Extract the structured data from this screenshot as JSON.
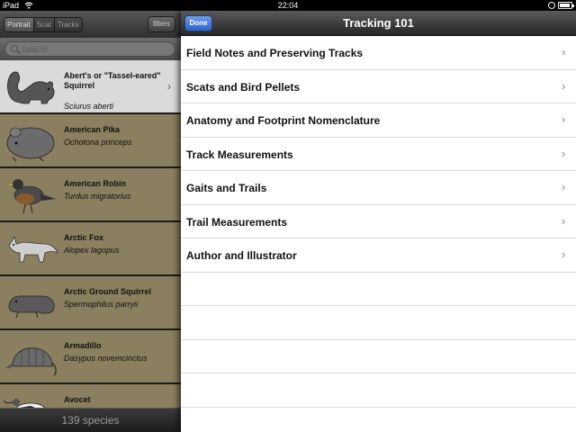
{
  "status_bar": {
    "carrier": "iPad",
    "time": "22:04",
    "battery_level": 0.95
  },
  "left_pane": {
    "segments": [
      "Portrait",
      "Scat",
      "Tracks"
    ],
    "active_segment": "Portrait",
    "filters_label": "filters",
    "search_placeholder": "Search",
    "species": [
      {
        "common": "Abert's or \"Tassel-eared\" Squirrel",
        "latin": "Sciurus aberti",
        "selected": true,
        "icon": "squirrel-icon"
      },
      {
        "common": "American Pika",
        "latin": "Ochotona princeps",
        "selected": false,
        "icon": "pika-icon"
      },
      {
        "common": "American Robin",
        "latin": "Turdus migratorius",
        "selected": false,
        "icon": "robin-icon"
      },
      {
        "common": "Arctic Fox",
        "latin": "Alopex lagopus",
        "selected": false,
        "icon": "fox-icon"
      },
      {
        "common": "Arctic Ground Squirrel",
        "latin": "Spermophilus parryii",
        "selected": false,
        "icon": "ground-squirrel-icon"
      },
      {
        "common": "Armadillo",
        "latin": "Dasypus novemcinctus",
        "selected": false,
        "icon": "armadillo-icon"
      },
      {
        "common": "Avocet",
        "latin": "",
        "selected": false,
        "icon": "avocet-icon"
      }
    ],
    "footer_count": "139 species"
  },
  "modal": {
    "done_label": "Done",
    "title": "Tracking 101",
    "items": [
      {
        "label": "Field Notes and Preserving Tracks"
      },
      {
        "label": "Scats and Bird Pellets"
      },
      {
        "label": "Anatomy and Footprint Nomenclature"
      },
      {
        "label": "Track Measurements"
      },
      {
        "label": "Gaits and Trails"
      },
      {
        "label": "Trail Measurements"
      },
      {
        "label": "Author and Illustrator"
      }
    ]
  },
  "colors": {
    "row_tan": "#8a7f5e",
    "row_selected": "#dadada",
    "done_blue": "#2f62c7"
  }
}
